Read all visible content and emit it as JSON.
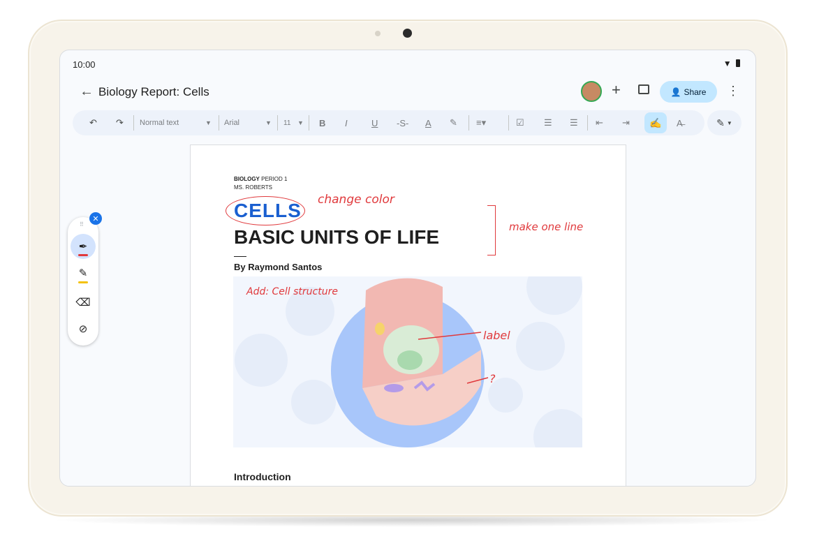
{
  "status": {
    "time": "10:00"
  },
  "header": {
    "back_icon": "arrow-back-icon",
    "doc_title": "Biology Report: Cells",
    "share_label": "Share"
  },
  "toolbar": {
    "style_select": "Normal text",
    "font_select": "Arial",
    "size_select": "11",
    "bold": "B",
    "italic": "I",
    "underline": "U",
    "text_color": "A"
  },
  "document": {
    "class_label_bold": "BIOLOGY",
    "class_label_rest": " PERIOD 1",
    "teacher": "MS. ROBERTS",
    "title_word": "CELLS",
    "subtitle": "BASIC UNITS OF LIFE",
    "byline": "By Raymond Santos",
    "section_heading": "Introduction"
  },
  "annotations": {
    "change_color": "change color",
    "make_one_line": "make one line",
    "add_cell_structure": "Add: Cell structure",
    "label": "label",
    "question": "?"
  },
  "colors": {
    "accent": "#1a73e8",
    "title_blue": "#1a5fd0",
    "ink_red": "#e0393c",
    "share_bg": "#c2e7ff",
    "highlighter": "#f4c20d"
  }
}
